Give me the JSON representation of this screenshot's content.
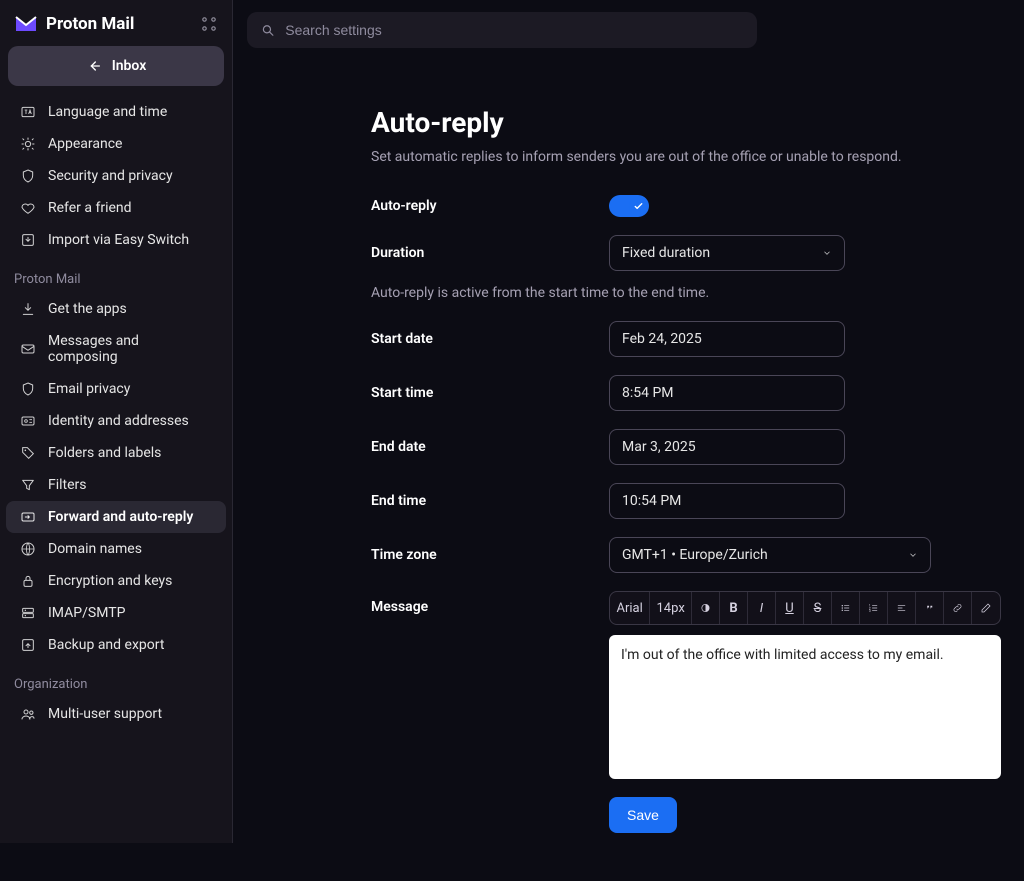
{
  "brand": {
    "name": "Proton Mail"
  },
  "inbox_button": "Inbox",
  "search": {
    "placeholder": "Search settings"
  },
  "sidebar": {
    "top_items": [
      {
        "icon": "language-icon",
        "label": "Language and time"
      },
      {
        "icon": "appearance-icon",
        "label": "Appearance"
      },
      {
        "icon": "shield-icon",
        "label": "Security and privacy"
      },
      {
        "icon": "heart-icon",
        "label": "Refer a friend"
      },
      {
        "icon": "import-icon",
        "label": "Import via Easy Switch"
      }
    ],
    "section1_label": "Proton Mail",
    "section1_items": [
      {
        "icon": "download-icon",
        "label": "Get the apps"
      },
      {
        "icon": "mail-icon",
        "label": "Messages and composing"
      },
      {
        "icon": "shield-icon",
        "label": "Email privacy"
      },
      {
        "icon": "id-card-icon",
        "label": "Identity and addresses"
      },
      {
        "icon": "tag-icon",
        "label": "Folders and labels"
      },
      {
        "icon": "filter-icon",
        "label": "Filters"
      },
      {
        "icon": "forward-icon",
        "label": "Forward and auto-reply",
        "active": true
      },
      {
        "icon": "globe-icon",
        "label": "Domain names"
      },
      {
        "icon": "lock-icon",
        "label": "Encryption and keys"
      },
      {
        "icon": "server-icon",
        "label": "IMAP/SMTP"
      },
      {
        "icon": "upload-icon",
        "label": "Backup and export"
      }
    ],
    "section2_label": "Organization",
    "section2_items": [
      {
        "icon": "users-icon",
        "label": "Multi-user support"
      }
    ]
  },
  "page": {
    "title": "Auto-reply",
    "subtitle": "Set automatic replies to inform senders you are out of the office or unable to respond.",
    "toggle_label": "Auto-reply",
    "toggle_on": true,
    "duration_label": "Duration",
    "duration_value": "Fixed duration",
    "duration_help": "Auto-reply is active from the start time to the end time.",
    "start_date_label": "Start date",
    "start_date_value": "Feb 24, 2025",
    "start_time_label": "Start time",
    "start_time_value": "8:54 PM",
    "end_date_label": "End date",
    "end_date_value": "Mar 3, 2025",
    "end_time_label": "End time",
    "end_time_value": "10:54 PM",
    "tz_label": "Time zone",
    "tz_value": "GMT+1 • Europe/Zurich",
    "message_label": "Message",
    "toolbar": {
      "font": "Arial",
      "size": "14px"
    },
    "message_body": "I'm out of the office with limited access to my email.",
    "save": "Save"
  }
}
